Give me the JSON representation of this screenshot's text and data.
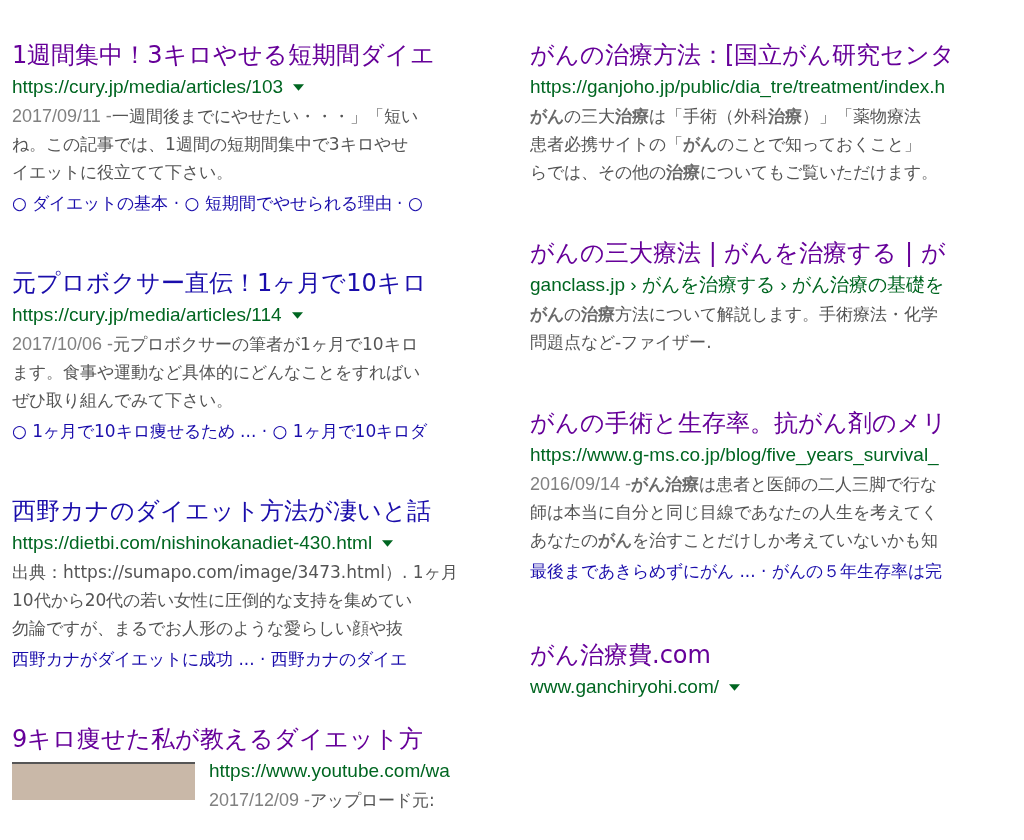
{
  "columns": [
    {
      "results": [
        {
          "title": "1週間集中！3キロやせる短期間ダイエ",
          "visited": true,
          "url": "https://cury.jp/media/articles/103",
          "menu_caret": true,
          "date": "2017/09/11 - ",
          "snippet": [
            "一週間後までにやせたい・・・」「短い",
            "ね。この記事では、1週間の短期間集中で3キロやせ",
            "イエットに役立てて下さい。"
          ],
          "sitelinks": "○ ダイエットの基本 · ○ 短期間でやせられる理由 · ○"
        },
        {
          "title": "元プロボクサー直伝！1ヶ月で10キロ",
          "visited": false,
          "url": "https://cury.jp/media/articles/114",
          "menu_caret": true,
          "date": "2017/10/06 - ",
          "snippet": [
            "元プロボクサーの筆者が1ヶ月で10キロ",
            "ます。食事や運動など具体的にどんなことをすればい",
            "ぜひ取り組んでみて下さい。"
          ],
          "sitelinks": "○ 1ヶ月で10キロ痩せるため ... · ○ 1ヶ月で10キロダ"
        },
        {
          "title": "西野カナのダイエット方法が凄いと話",
          "visited": false,
          "url": "https://dietbi.com/nishinokanadiet-430.html",
          "menu_caret": true,
          "snippet": [
            "出典：https://sumapo.com/image/3473.html）. 1ヶ月",
            "10代から20代の若い女性に圧倒的な支持を集めてい",
            "勿論ですが、まるでお人形のような愛らしい顔や抜"
          ],
          "sitelinks": "西野カナがダイエットに成功 ... · 西野カナのダイエ"
        },
        {
          "title": "9キロ痩せた私が教えるダイエット方",
          "visited": true,
          "url": "https://www.youtube.com/wa",
          "menu_caret": false,
          "thumbnail": true,
          "date": "2017/12/09 - ",
          "snippet": [
            "アップロード元:"
          ]
        }
      ]
    },
    {
      "results": [
        {
          "title": "がんの治療方法：[国立がん研究センタ",
          "visited": true,
          "url": "https://ganjoho.jp/public/dia_tre/treatment/index.h",
          "menu_caret": false,
          "snippet": [
            "**がん**の三大**治療**は「手術（外科**治療**）」「薬物療法",
            "患者必携サイトの「**がん**のことで知っておくこと」",
            "らでは、その他の**治療**についてもご覧いただけます。"
          ]
        },
        {
          "title": "がんの三大療法 | がんを治療する | が",
          "visited": true,
          "url": "ganclass.jp › がんを治療する › がん治療の基礎を",
          "menu_caret": false,
          "snippet": [
            "**がん**の**治療**方法について解説します。手術療法・化学",
            "問題点など-ファイザー."
          ]
        },
        {
          "title": "がんの手術と生存率。抗がん剤のメリ",
          "visited": true,
          "url": "https://www.g-ms.co.jp/blog/five_years_survival_",
          "menu_caret": false,
          "date": "2016/09/14 - ",
          "snippet": [
            "**がん治療**は患者と医師の二人三脚で行な",
            "師は本当に自分と同じ目線であなたの人生を考えてく",
            "あなたの**がん**を治すことだけしか考えていないかも知"
          ],
          "sitelinks": "最後まであきらめずにがん ... · がんの５年生存率は完"
        },
        {
          "title": "がん治療費.com",
          "visited": true,
          "url": "www.ganchiryohi.com/",
          "menu_caret": true
        }
      ]
    }
  ]
}
